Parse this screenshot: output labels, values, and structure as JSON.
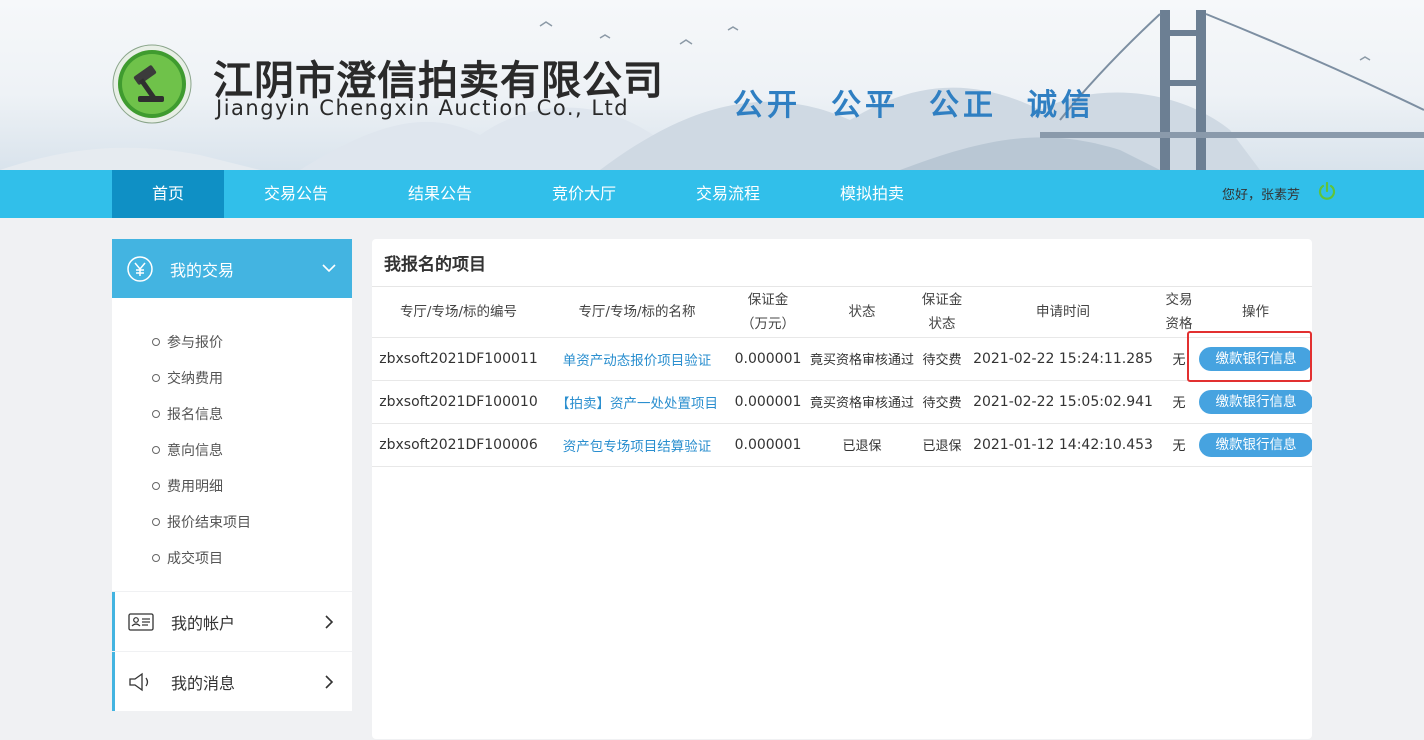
{
  "header": {
    "company_cn": "江阴市澄信拍卖有限公司",
    "company_en": "Jiangyin Chengxin Auction Co., Ltd",
    "slogan": [
      "公开",
      "公平",
      "公正",
      "诚信"
    ]
  },
  "nav": {
    "items": [
      {
        "label": "首页",
        "active": true
      },
      {
        "label": "交易公告"
      },
      {
        "label": "结果公告"
      },
      {
        "label": "竞价大厅"
      },
      {
        "label": "交易流程"
      },
      {
        "label": "模拟拍卖"
      }
    ],
    "greeting": "您好，张素芳"
  },
  "sidebar": {
    "section_trade": "我的交易",
    "trade_items": [
      "参与报价",
      "交纳费用",
      "报名信息",
      "意向信息",
      "费用明细",
      "报价结束项目",
      "成交项目"
    ],
    "section_account": "我的帐户",
    "section_message": "我的消息"
  },
  "panel": {
    "title": "我报名的项目",
    "columns": {
      "code": "专厅/专场/标的编号",
      "name": "专厅/专场/标的名称",
      "deposit_l1": "保证金",
      "deposit_l2": "（万元）",
      "status": "状态",
      "deposit_status_l1": "保证金",
      "deposit_status_l2": "状态",
      "apply_time": "申请时间",
      "qual_l1": "交易",
      "qual_l2": "资格",
      "action": "操作"
    },
    "rows": [
      {
        "code": "zbxsoft2021DF100011",
        "name": "单资产动态报价项目验证",
        "deposit": "0.000001",
        "status": "竟买资格审核通过",
        "deposit_status": "待交费",
        "apply_time": "2021-02-22 15:24:11.285",
        "qual": "无",
        "action": "缴款银行信息"
      },
      {
        "code": "zbxsoft2021DF100010",
        "name": "【拍卖】资产一处处置项目",
        "deposit": "0.000001",
        "status": "竟买资格审核通过",
        "deposit_status": "待交费",
        "apply_time": "2021-02-22 15:05:02.941",
        "qual": "无",
        "action": "缴款银行信息"
      },
      {
        "code": "zbxsoft2021DF100006",
        "name": "资产包专场项目结算验证",
        "deposit": "0.000001",
        "status": "已退保",
        "deposit_status": "已退保",
        "apply_time": "2021-01-12 14:42:10.453",
        "qual": "无",
        "action": "缴款银行信息"
      }
    ]
  },
  "colors": {
    "nav_bg": "#31bfea",
    "nav_active": "#0f90c5",
    "side_head": "#43b4e1",
    "button": "#46a3e0",
    "link": "#2b8fcf",
    "slogan": "#2f7fc2",
    "highlight": "#e23030"
  },
  "icons": {
    "logo": "auction-gavel-logo",
    "power": "power-icon",
    "trade": "yen-circle-icon",
    "account": "id-card-icon",
    "message": "speaker-icon"
  }
}
